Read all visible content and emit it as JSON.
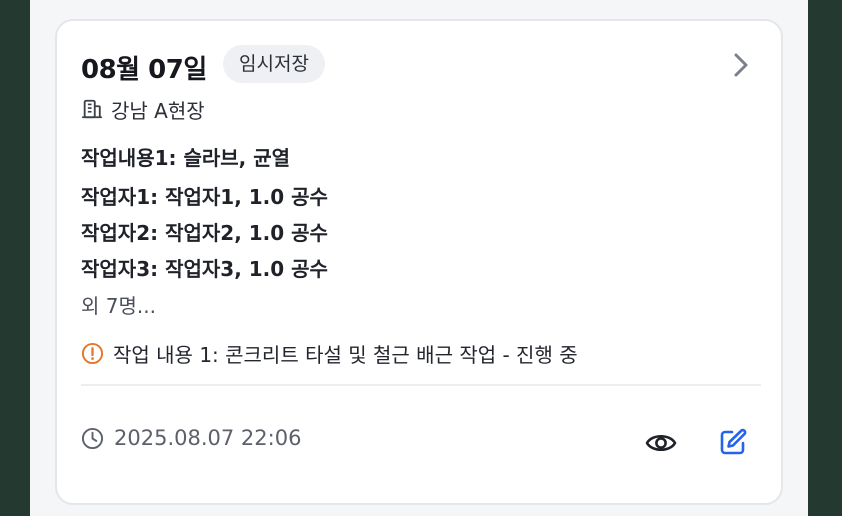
{
  "card": {
    "date": "08월 07일",
    "badge": "임시저장",
    "site": "강남 A현장",
    "work_content": "작업내용1: 슬라브, 균열",
    "workers": [
      "작업자1: 작업자1, 1.0 공수",
      "작업자2: 작업자2, 1.0 공수",
      "작업자3: 작업자3, 1.0 공수"
    ],
    "more_workers": "외 7명...",
    "note": "작업 내용 1: 콘크리트 타설 및 철근 배근 작업 - 진행 중",
    "timestamp": "2025.08.07 22:06"
  },
  "icons": {
    "site": "building-icon",
    "note": "alert-circle-icon",
    "time": "clock-icon",
    "view": "eye-icon",
    "edit": "edit-icon",
    "open": "chevron-right-icon"
  },
  "colors": {
    "note_icon": "#e8742a",
    "edit_icon": "#2563eb"
  }
}
